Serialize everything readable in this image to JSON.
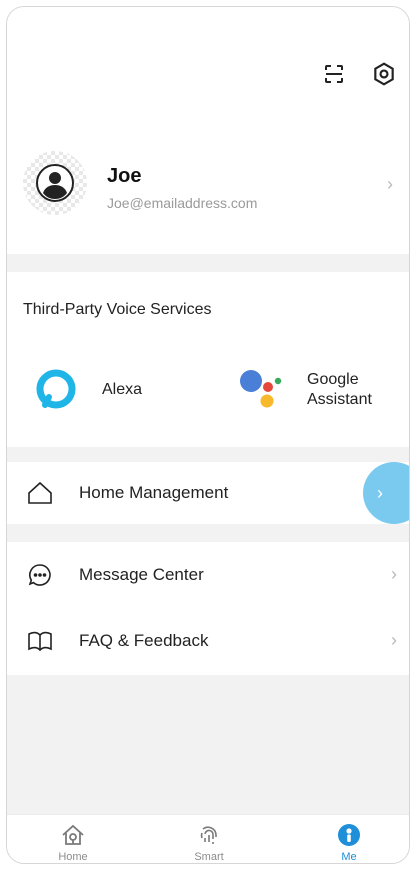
{
  "header": {
    "scan_icon": "scan-icon",
    "settings_icon": "settings-icon"
  },
  "profile": {
    "name": "Joe",
    "email": "Joe@emailaddress.com"
  },
  "voice_services": {
    "title": "Third-Party Voice Services",
    "items": [
      {
        "label": "Alexa",
        "icon": "alexa-icon"
      },
      {
        "label_line1": "Google",
        "label_line2": "Assistant",
        "icon": "google-assistant-icon"
      }
    ]
  },
  "menu": {
    "home_management": "Home Management",
    "message_center": "Message Center",
    "faq_feedback": "FAQ & Feedback"
  },
  "tabs": [
    {
      "label": "Home",
      "icon": "home-icon"
    },
    {
      "label": "Smart",
      "icon": "smart-icon"
    },
    {
      "label": "Me",
      "icon": "me-icon",
      "active": true
    }
  ],
  "colors": {
    "accent": "#1e8fd8",
    "fab": "#6cc4ee",
    "alexa": "#1fb5e6"
  }
}
